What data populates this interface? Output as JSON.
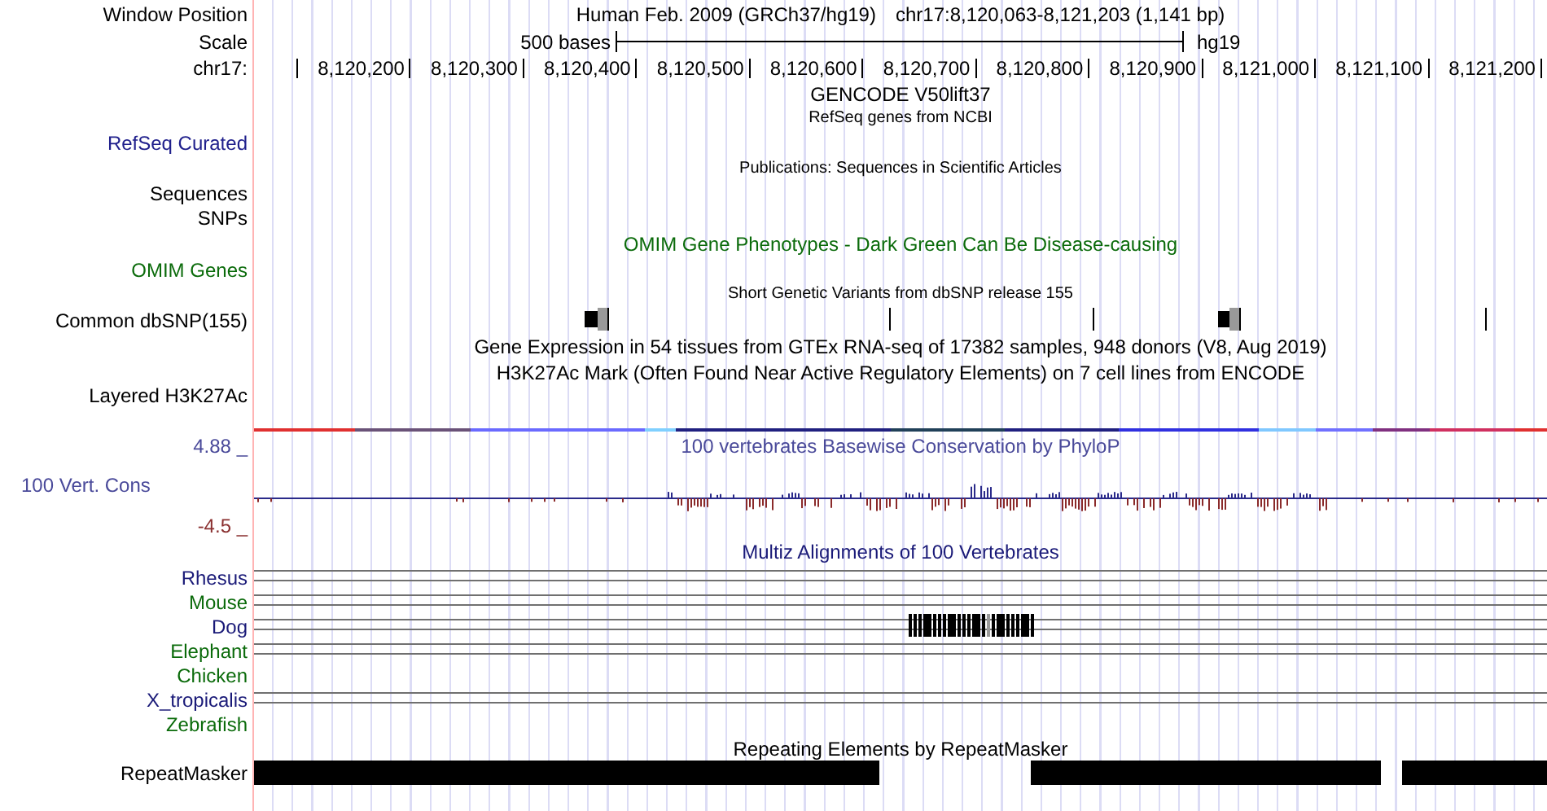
{
  "header": {
    "position_label": "Window Position",
    "assembly": "Human Feb. 2009 (GRCh37/hg19)",
    "position": "chr17:8,120,063-8,121,203 (1,141 bp)",
    "scale_label": "Scale",
    "scale_text": "500 bases",
    "scale_db": "hg19",
    "chrom_label": "chr17:",
    "ruler_ticks": [
      "8,120,200",
      "8,120,300",
      "8,120,400",
      "8,120,500",
      "8,120,600",
      "8,120,700",
      "8,120,800",
      "8,120,900",
      "8,121,000",
      "8,121,100",
      "8,121,200"
    ]
  },
  "gencode": {
    "title": "GENCODE V50lift37"
  },
  "refseq": {
    "title": "RefSeq genes from NCBI",
    "label": "RefSeq Curated"
  },
  "publications": {
    "title": "Publications: Sequences in Scientific Articles",
    "labels": [
      "Sequences",
      "SNPs"
    ]
  },
  "omim": {
    "title": "OMIM Gene Phenotypes - Dark Green Can Be Disease-causing",
    "label": "OMIM Genes"
  },
  "dbsnp": {
    "title": "Short Genetic Variants from dbSNP release 155",
    "label": "Common dbSNP(155)"
  },
  "gtex": {
    "title": "Gene Expression in 54 tissues from GTEx RNA-seq of 17382 samples, 948 donors (V8, Aug 2019)"
  },
  "h3k27ac": {
    "title": "H3K27Ac Mark (Often Found Near Active Regulatory Elements) on 7 cell lines from ENCODE",
    "label": "Layered H3K27Ac"
  },
  "conservation": {
    "title": "100 vertebrates Basewise Conservation by PhyloP",
    "label": "100 Vert. Cons",
    "max": "4.88 _",
    "min": "-4.5 _"
  },
  "multiz": {
    "title": "Multiz Alignments of 100 Vertebrates",
    "species": [
      {
        "name": "Rhesus",
        "color": "#1a1a78",
        "aligned": true
      },
      {
        "name": "Mouse",
        "color": "#0b6b0b",
        "aligned": true
      },
      {
        "name": "Dog",
        "color": "#1a1a78",
        "aligned": true
      },
      {
        "name": "Elephant",
        "color": "#0b6b0b",
        "aligned": true
      },
      {
        "name": "Chicken",
        "color": "#0b6b0b",
        "aligned": false
      },
      {
        "name": "X_tropicalis",
        "color": "#1a1a78",
        "aligned": true
      },
      {
        "name": "Zebrafish",
        "color": "#0b6b0b",
        "aligned": false
      }
    ]
  },
  "repeatmasker": {
    "title": "Repeating Elements by RepeatMasker",
    "label": "RepeatMasker"
  }
}
